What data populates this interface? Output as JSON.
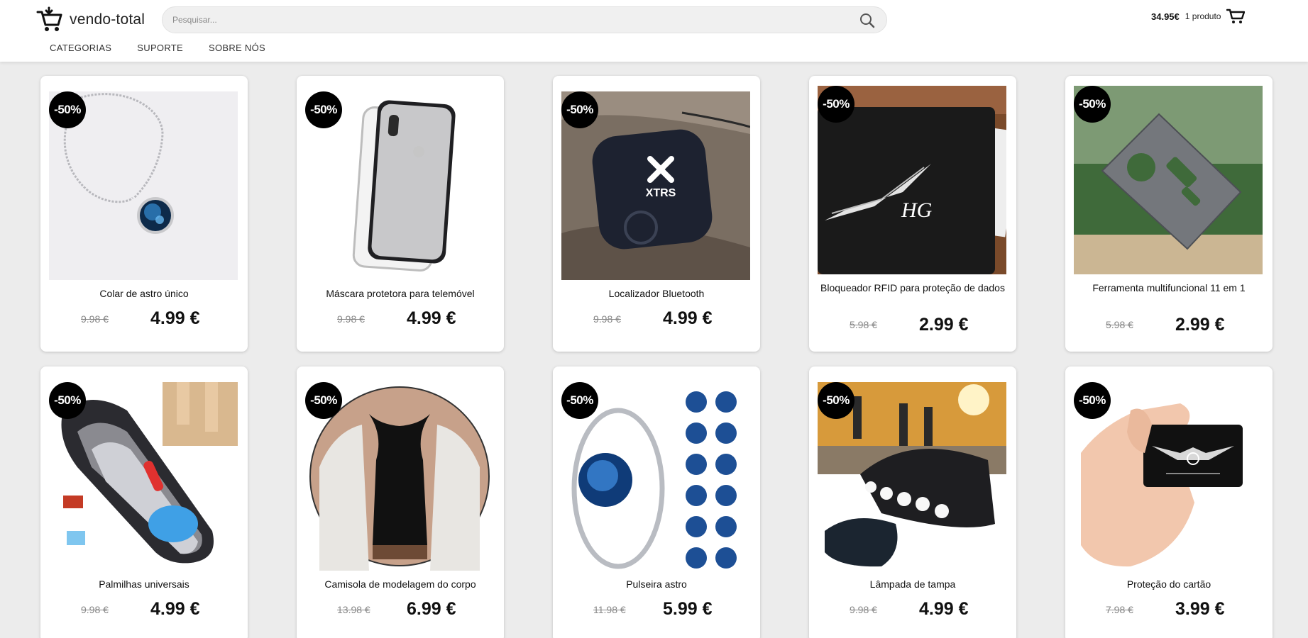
{
  "header": {
    "logo_text": "vendo-total",
    "search_placeholder": "Pesquisar...",
    "cart_total": "34.95€",
    "cart_count": "1 produto"
  },
  "nav": [
    "CATEGORIAS",
    "SUPORTE",
    "SOBRE NÓS"
  ],
  "products": [
    {
      "title": "Colar de astro único",
      "old_price": "9.98 €",
      "price": "4.99 €",
      "discount": "-50%"
    },
    {
      "title": "Máscara protetora para telemóvel",
      "old_price": "9.98 €",
      "price": "4.99 €",
      "discount": "-50%"
    },
    {
      "title": "Localizador Bluetooth",
      "old_price": "9.98 €",
      "price": "4.99 €",
      "discount": "-50%",
      "image_text": "XTRS"
    },
    {
      "title": "Bloqueador RFID para proteção de dados",
      "old_price": "5.98 €",
      "price": "2.99 €",
      "discount": "-50%",
      "image_text": "HG"
    },
    {
      "title": "Ferramenta multifuncional 11 em 1",
      "old_price": "5.98 €",
      "price": "2.99 €",
      "discount": "-50%"
    },
    {
      "title": "Palmilhas universais",
      "old_price": "9.98 €",
      "price": "4.99 €",
      "discount": "-50%"
    },
    {
      "title": "Camisola de modelagem do corpo",
      "old_price": "13.98 €",
      "price": "6.99 €",
      "discount": "-50%"
    },
    {
      "title": "Pulseira astro",
      "old_price": "11.98 €",
      "price": "5.99 €",
      "discount": "-50%"
    },
    {
      "title": "Lâmpada de tampa",
      "old_price": "9.98 €",
      "price": "4.99 €",
      "discount": "-50%"
    },
    {
      "title": "Proteção do cartão",
      "old_price": "7.98 €",
      "price": "3.99 €",
      "discount": "-50%"
    }
  ]
}
